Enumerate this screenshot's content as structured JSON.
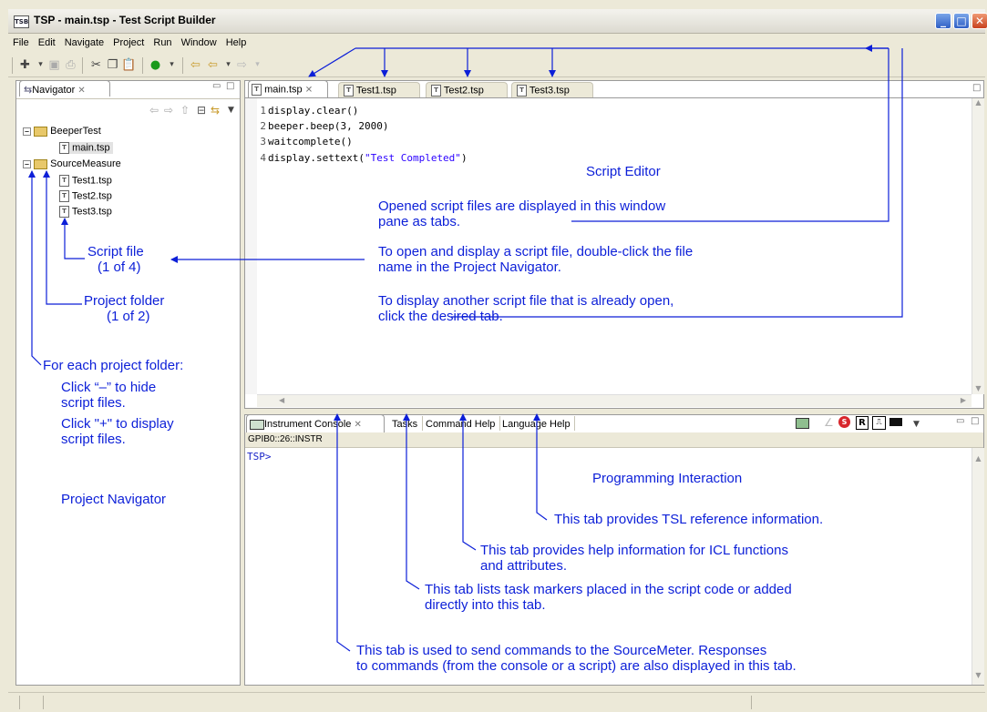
{
  "window": {
    "app_icon": "TSB",
    "title": "TSP - main.tsp - Test Script Builder"
  },
  "menu": [
    "File",
    "Edit",
    "Navigate",
    "Project",
    "Run",
    "Window",
    "Help"
  ],
  "navigator": {
    "tab_label": "Navigator",
    "tree": [
      {
        "label": "BeeperTest",
        "expander": "−",
        "kind": "folder"
      },
      {
        "label": "main.tsp",
        "kind": "file"
      },
      {
        "label": "SourceMeasure",
        "expander": "−",
        "kind": "folder"
      },
      {
        "label": "Test1.tsp",
        "kind": "file"
      },
      {
        "label": "Test2.tsp",
        "kind": "file"
      },
      {
        "label": "Test3.tsp",
        "kind": "file"
      }
    ]
  },
  "editor": {
    "tabs": [
      "main.tsp",
      "Test1.tsp",
      "Test2.tsp",
      "Test3.tsp"
    ],
    "active_tab": "main.tsp",
    "lines": [
      {
        "n": "1",
        "code": "display.clear()",
        "str": ""
      },
      {
        "n": "2",
        "code": "beeper.beep(3, 2000)",
        "str": ""
      },
      {
        "n": "3",
        "code": "waitcomplete()",
        "str": ""
      },
      {
        "n": "4",
        "code": "display.settext(",
        "str": "\"Test Completed\"",
        "end": ")"
      }
    ]
  },
  "console": {
    "tabs": [
      "Instrument Console",
      "Tasks",
      "Command Help",
      "Language Help"
    ],
    "resource": "GPIB0::26::INSTR",
    "prompt": "TSP>"
  },
  "annotations": {
    "script_editor": "Script Editor",
    "opened_1": "Opened script files are displayed in this window",
    "opened_2": "pane as tabs.",
    "open_1": "To open and display a script file, double-click the file",
    "open_2": "name in the Project Navigator.",
    "another_1": "To display another script file that is already open,",
    "another_2": "click the desired tab.",
    "script_file_1": "Script file",
    "script_file_2": "(1 of 4)",
    "project_folder_1": "Project folder",
    "project_folder_2": "(1 of 2)",
    "for_each": "For each project folder:",
    "click_minus_1": "Click “–” to hide",
    "click_minus_2": "script files.",
    "click_plus_1": "Click \"+\" to display",
    "click_plus_2": "script files.",
    "project_navigator": "Project Navigator",
    "prog_interaction": "Programming Interaction",
    "tsl": "This tab provides TSL reference information.",
    "icl_1": "This tab provides help information for ICL functions",
    "icl_2": "and attributes.",
    "tasks_1": "This tab lists task markers placed in the script code or added",
    "tasks_2": "directly into this tab.",
    "console_1": "This tab is used to send commands to the SourceMeter. Responses",
    "console_2": "to commands (from the console or a script) are also displayed in this tab."
  },
  "colors": {
    "annotation": "#0c1fd8",
    "string_literal": "#2a00ff"
  }
}
